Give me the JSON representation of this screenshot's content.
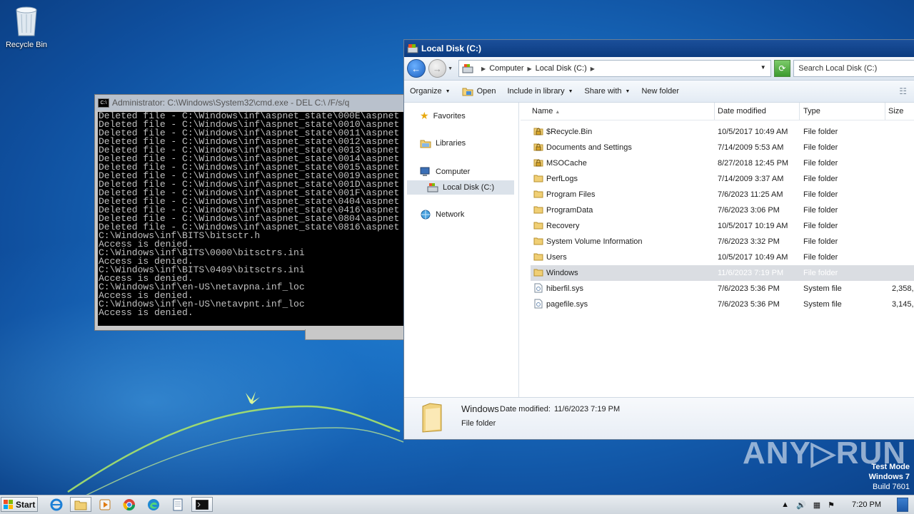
{
  "desktop": {
    "recycle_bin_label": "Recycle Bin",
    "watermark": "ANY▷RUN",
    "test_mode": {
      "line1": "Test Mode",
      "line2": "Windows 7",
      "line3": "Build 7601"
    }
  },
  "cmd": {
    "title": "Administrator: C:\\Windows\\System32\\cmd.exe - DEL  C:\\ /F/s/q",
    "lines": [
      "Deleted file - C:\\Windows\\inf\\aspnet_state\\000E\\aspnet",
      "Deleted file - C:\\Windows\\inf\\aspnet_state\\0010\\aspnet",
      "Deleted file - C:\\Windows\\inf\\aspnet_state\\0011\\aspnet",
      "Deleted file - C:\\Windows\\inf\\aspnet_state\\0012\\aspnet",
      "Deleted file - C:\\Windows\\inf\\aspnet_state\\0013\\aspnet",
      "Deleted file - C:\\Windows\\inf\\aspnet_state\\0014\\aspnet",
      "Deleted file - C:\\Windows\\inf\\aspnet_state\\0015\\aspnet",
      "Deleted file - C:\\Windows\\inf\\aspnet_state\\0019\\aspnet",
      "Deleted file - C:\\Windows\\inf\\aspnet_state\\001D\\aspnet",
      "Deleted file - C:\\Windows\\inf\\aspnet_state\\001F\\aspnet",
      "Deleted file - C:\\Windows\\inf\\aspnet_state\\0404\\aspnet",
      "Deleted file - C:\\Windows\\inf\\aspnet_state\\0416\\aspnet",
      "Deleted file - C:\\Windows\\inf\\aspnet_state\\0804\\aspnet",
      "Deleted file - C:\\Windows\\inf\\aspnet_state\\0816\\aspnet",
      "C:\\Windows\\inf\\BITS\\bitsctr.h",
      "Access is denied.",
      "C:\\Windows\\inf\\BITS\\0000\\bitsctrs.ini",
      "Access is denied.",
      "C:\\Windows\\inf\\BITS\\0409\\bitsctrs.ini",
      "Access is denied.",
      "C:\\Windows\\inf\\en-US\\netavpna.inf_loc",
      "Access is denied.",
      "C:\\Windows\\inf\\en-US\\netavpnt.inf_loc",
      "Access is denied."
    ]
  },
  "explorer": {
    "title": "Local Disk (C:)",
    "breadcrumb": [
      "Computer",
      "Local Disk (C:)"
    ],
    "search_placeholder": "Search Local Disk (C:)",
    "toolbar": {
      "organize": "Organize",
      "open": "Open",
      "include_in_library": "Include in library",
      "share_with": "Share with",
      "new_folder": "New folder"
    },
    "nav": {
      "favorites": "Favorites",
      "libraries": "Libraries",
      "computer": "Computer",
      "local_disk": "Local Disk (C:)",
      "network": "Network"
    },
    "columns": {
      "name": "Name",
      "date_modified": "Date modified",
      "type": "Type",
      "size": "Size"
    },
    "rows": [
      {
        "name": "$Recycle.Bin",
        "date": "10/5/2017 10:49 AM",
        "type": "File folder",
        "size": "",
        "icon": "locked-folder-icon"
      },
      {
        "name": "Documents and Settings",
        "date": "7/14/2009 5:53 AM",
        "type": "File folder",
        "size": "",
        "icon": "locked-folder-icon"
      },
      {
        "name": "MSOCache",
        "date": "8/27/2018 12:45 PM",
        "type": "File folder",
        "size": "",
        "icon": "locked-folder-icon"
      },
      {
        "name": "PerfLogs",
        "date": "7/14/2009 3:37 AM",
        "type": "File folder",
        "size": "",
        "icon": "folder-icon"
      },
      {
        "name": "Program Files",
        "date": "7/6/2023 11:25 AM",
        "type": "File folder",
        "size": "",
        "icon": "folder-icon"
      },
      {
        "name": "ProgramData",
        "date": "7/6/2023 3:06 PM",
        "type": "File folder",
        "size": "",
        "icon": "folder-icon"
      },
      {
        "name": "Recovery",
        "date": "10/5/2017 10:19 AM",
        "type": "File folder",
        "size": "",
        "icon": "folder-icon"
      },
      {
        "name": "System Volume Information",
        "date": "7/6/2023 3:32 PM",
        "type": "File folder",
        "size": "",
        "icon": "folder-icon"
      },
      {
        "name": "Users",
        "date": "10/5/2017 10:49 AM",
        "type": "File folder",
        "size": "",
        "icon": "folder-icon"
      },
      {
        "name": "Windows",
        "date": "11/6/2023 7:19 PM",
        "type": "File folder",
        "size": "",
        "icon": "folder-icon"
      },
      {
        "name": "hiberfil.sys",
        "date": "7/6/2023 5:36 PM",
        "type": "System file",
        "size": "2,358,",
        "icon": "system-file-icon"
      },
      {
        "name": "pagefile.sys",
        "date": "7/6/2023 5:36 PM",
        "type": "System file",
        "size": "3,145,",
        "icon": "system-file-icon"
      }
    ],
    "selected_row": 9,
    "details": {
      "name": "Windows",
      "date_label": "Date modified:",
      "date_value": "11/6/2023 7:19 PM",
      "type": "File folder"
    }
  },
  "taskbar": {
    "start_label": "Start",
    "clock": "7:20 PM",
    "apps": [
      "ie-icon",
      "explorer-icon",
      "media-player-icon",
      "chrome-icon",
      "edge-icon",
      "notepad-icon",
      "cmd-icon"
    ]
  }
}
